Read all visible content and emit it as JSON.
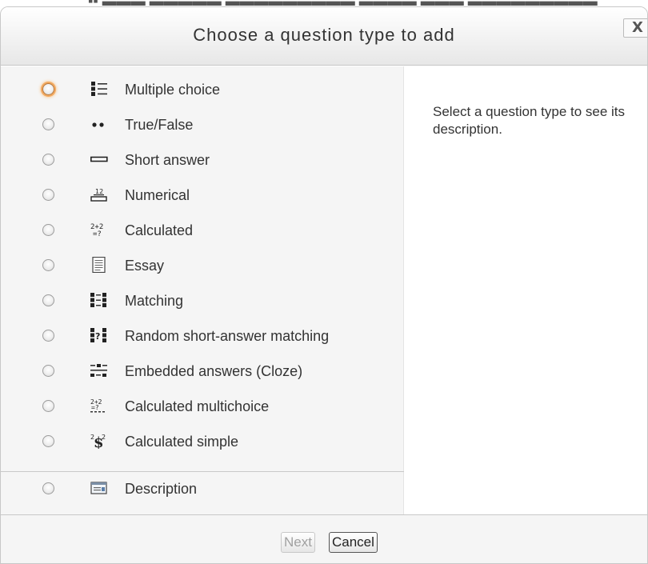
{
  "dialog": {
    "title": "Choose a question type to add",
    "close_label": "X"
  },
  "options": [
    {
      "label": "Multiple choice",
      "icon": "multiple-choice-icon",
      "focused": true
    },
    {
      "label": "True/False",
      "icon": "true-false-icon"
    },
    {
      "label": "Short answer",
      "icon": "short-answer-icon"
    },
    {
      "label": "Numerical",
      "icon": "numerical-icon"
    },
    {
      "label": "Calculated",
      "icon": "calculated-icon"
    },
    {
      "label": "Essay",
      "icon": "essay-icon"
    },
    {
      "label": "Matching",
      "icon": "matching-icon"
    },
    {
      "label": "Random short-answer matching",
      "icon": "random-short-answer-matching-icon"
    },
    {
      "label": "Embedded answers (Cloze)",
      "icon": "embedded-answers-icon"
    },
    {
      "label": "Calculated multichoice",
      "icon": "calculated-multichoice-icon"
    },
    {
      "label": "Calculated simple",
      "icon": "calculated-simple-icon"
    },
    {
      "label": "Description",
      "icon": "description-icon"
    }
  ],
  "description": {
    "placeholder": "Select a question type to see its description."
  },
  "footer": {
    "next_label": "Next",
    "cancel_label": "Cancel"
  },
  "colors": {
    "focus_ring": "#f2a95f",
    "panel_bg": "#f5f5f5"
  }
}
